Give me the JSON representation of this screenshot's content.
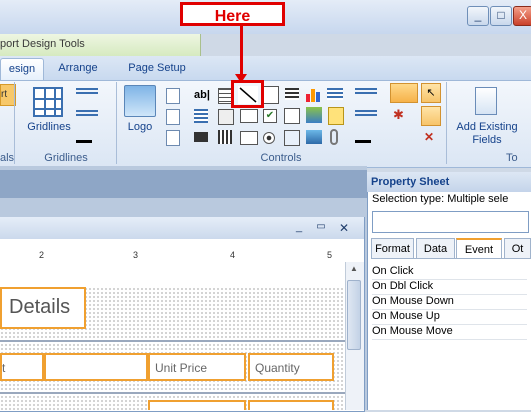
{
  "annotation": {
    "label": "Here"
  },
  "window": {
    "controls": [
      "_",
      "□",
      "X"
    ]
  },
  "contextual_tab": {
    "label": "port Design Tools"
  },
  "tabs": [
    {
      "label": "esign"
    },
    {
      "label": "Arrange"
    },
    {
      "label": "Page Setup"
    }
  ],
  "ribbon": {
    "left_button": "rt",
    "gridlines_button": "Gridlines",
    "logo_button": "Logo",
    "text_box_icon": "ab|",
    "add_fields_button": "Add Existing Fields",
    "groups": {
      "cut_left": "als",
      "gridlines": "Gridlines",
      "controls": "Controls",
      "cut_right": "To"
    }
  },
  "report": {
    "title_text": "Details",
    "fields": [
      "t",
      "Unit Price",
      "Quantity"
    ],
    "ruler_marks": [
      "2",
      "3",
      "4",
      "5"
    ]
  },
  "property_sheet": {
    "title": "Property Sheet",
    "selection_label": "Selection type:",
    "selection_value": "Multiple sele",
    "tabs": [
      "Format",
      "Data",
      "Event",
      "Ot"
    ],
    "active_tab": "Event",
    "rows": [
      "On Click",
      "On Dbl Click",
      "On Mouse Down",
      "On Mouse Up",
      "On Mouse Move"
    ]
  }
}
